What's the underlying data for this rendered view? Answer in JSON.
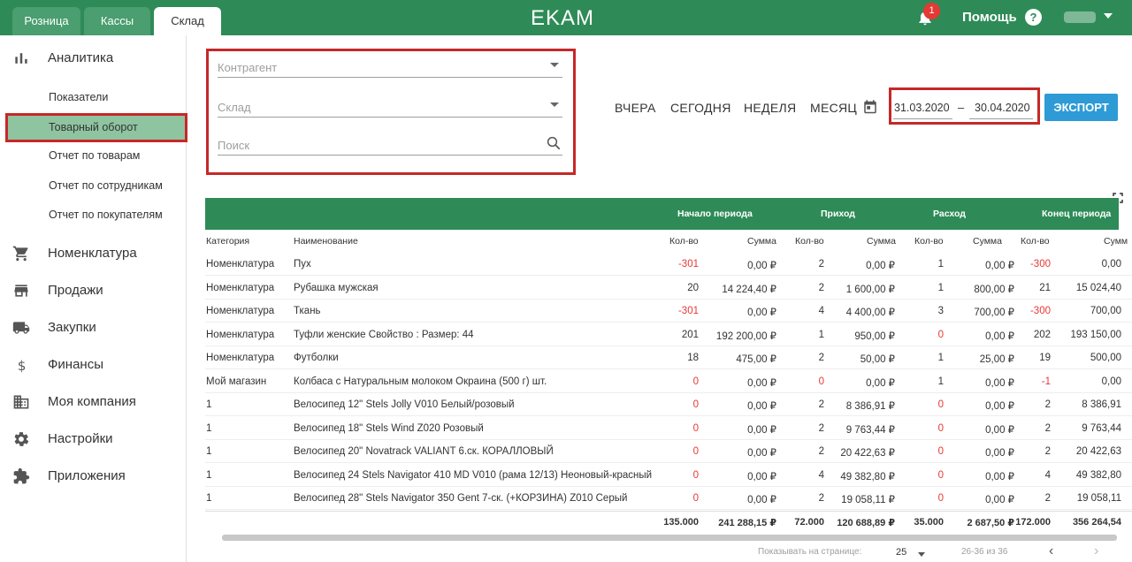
{
  "header": {
    "tabs": [
      {
        "label": "Розница"
      },
      {
        "label": "Кассы"
      },
      {
        "label": "Склад"
      }
    ],
    "logo": "EKAM",
    "notifications": "1",
    "help": "Помощь",
    "help_icon": "?"
  },
  "sidebar": {
    "sections": [
      {
        "label": "Аналитика",
        "icon": "chart-icon"
      },
      {
        "label": "Номенклатура",
        "icon": "cart-icon"
      },
      {
        "label": "Продажи",
        "icon": "store-icon"
      },
      {
        "label": "Закупки",
        "icon": "truck-icon"
      },
      {
        "label": "Финансы",
        "icon": "dollar-icon"
      },
      {
        "label": "Моя компания",
        "icon": "building-icon"
      },
      {
        "label": "Настройки",
        "icon": "gear-icon"
      },
      {
        "label": "Приложения",
        "icon": "puzzle-icon"
      }
    ],
    "analytics_items": [
      {
        "label": "Показатели"
      },
      {
        "label": "Товарный оборот"
      },
      {
        "label": "Отчет по товарам"
      },
      {
        "label": "Отчет по сотрудникам"
      },
      {
        "label": "Отчет по покупателям"
      }
    ]
  },
  "filters": {
    "counterparty": "Контрагент",
    "warehouse": "Склад",
    "search": "Поиск"
  },
  "period": {
    "yesterday": "ВЧЕРА",
    "today": "СЕГОДНЯ",
    "week": "НЕДЕЛЯ",
    "month": "МЕСЯЦ",
    "date_from": "31.03.2020",
    "dash": "–",
    "date_to": "30.04.2020",
    "export": "ЭКСПОРТ"
  },
  "table": {
    "groups": {
      "start": "Начало периода",
      "income": "Приход",
      "expense": "Расход",
      "end": "Конец периода"
    },
    "columns": {
      "category": "Категория",
      "name": "Наименование",
      "qty": "Кол-во",
      "sum": "Сумма",
      "sum_cut": "Сумм"
    },
    "rows": [
      {
        "cat": "Номенклатура",
        "name": "Пух",
        "q1": "-301",
        "s1": "0,00 ₽",
        "q2": "2",
        "s2": "0,00 ₽",
        "q3": "1",
        "s3": "0,00 ₽",
        "q4": "-300",
        "s4": "0,00"
      },
      {
        "cat": "Номенклатура",
        "name": "Рубашка мужская",
        "q1": "20",
        "s1": "14 224,40 ₽",
        "q2": "2",
        "s2": "1 600,00 ₽",
        "q3": "1",
        "s3": "800,00 ₽",
        "q4": "21",
        "s4": "15 024,40"
      },
      {
        "cat": "Номенклатура",
        "name": "Ткань",
        "q1": "-301",
        "s1": "0,00 ₽",
        "q2": "4",
        "s2": "4 400,00 ₽",
        "q3": "3",
        "s3": "700,00 ₽",
        "q4": "-300",
        "s4": "700,00"
      },
      {
        "cat": "Номенклатура",
        "name": "Туфли женские Свойство : Размер: 44",
        "q1": "201",
        "s1": "192 200,00 ₽",
        "q2": "1",
        "s2": "950,00 ₽",
        "q3": "0",
        "s3": "0,00 ₽",
        "q4": "202",
        "s4": "193 150,00"
      },
      {
        "cat": "Номенклатура",
        "name": "Футболки",
        "q1": "18",
        "s1": "475,00 ₽",
        "q2": "2",
        "s2": "50,00 ₽",
        "q3": "1",
        "s3": "25,00 ₽",
        "q4": "19",
        "s4": "500,00"
      },
      {
        "cat": "Мой магазин",
        "name": "Колбаса с Натуральным молоком Окраина (500 г) шт.",
        "q1": "0",
        "s1": "0,00 ₽",
        "q2": "0",
        "s2": "0,00 ₽",
        "q3": "1",
        "s3": "0,00 ₽",
        "q4": "-1",
        "s4": "0,00"
      },
      {
        "cat": "1",
        "name": "Велосипед 12\" Stels Jolly V010 Белый/розовый",
        "q1": "0",
        "s1": "0,00 ₽",
        "q2": "2",
        "s2": "8 386,91 ₽",
        "q3": "0",
        "s3": "0,00 ₽",
        "q4": "2",
        "s4": "8 386,91"
      },
      {
        "cat": "1",
        "name": "Велосипед 18\" Stels Wind Z020 Розовый",
        "q1": "0",
        "s1": "0,00 ₽",
        "q2": "2",
        "s2": "9 763,44 ₽",
        "q3": "0",
        "s3": "0,00 ₽",
        "q4": "2",
        "s4": "9 763,44"
      },
      {
        "cat": "1",
        "name": "Велосипед 20\" Novatrack VALIANT 6.ск. КОРАЛЛОВЫЙ",
        "q1": "0",
        "s1": "0,00 ₽",
        "q2": "2",
        "s2": "20 422,63 ₽",
        "q3": "0",
        "s3": "0,00 ₽",
        "q4": "2",
        "s4": "20 422,63"
      },
      {
        "cat": "1",
        "name": "Велосипед 24 Stels Navigator 410 MD V010 (рама 12/13) Неоновый-красный",
        "q1": "0",
        "s1": "0,00 ₽",
        "q2": "4",
        "s2": "49 382,80 ₽",
        "q3": "0",
        "s3": "0,00 ₽",
        "q4": "4",
        "s4": "49 382,80"
      },
      {
        "cat": "1",
        "name": "Велосипед 28\" Stels Navigator 350 Gent 7-ск. (+КОРЗИНА) Z010 Серый",
        "q1": "0",
        "s1": "0,00 ₽",
        "q2": "2",
        "s2": "19 058,11 ₽",
        "q3": "0",
        "s3": "0,00 ₽",
        "q4": "2",
        "s4": "19 058,11"
      }
    ],
    "totals": {
      "q1": "135.000",
      "s1": "241 288,15 ₽",
      "q2": "72.000",
      "s2": "120 688,89 ₽",
      "q3": "35.000",
      "s3": "2 687,50 ₽",
      "q4": "172.000",
      "s4": "356 264,54"
    }
  },
  "pager": {
    "label": "Показывать на странице:",
    "size": "25",
    "range": "26-36 из 36",
    "prev": "‹",
    "next": "›"
  },
  "colors": {
    "brand": "#2e8b57",
    "accent": "#2e9bd6",
    "negative": "#e53935",
    "highlight": "#c62828"
  }
}
